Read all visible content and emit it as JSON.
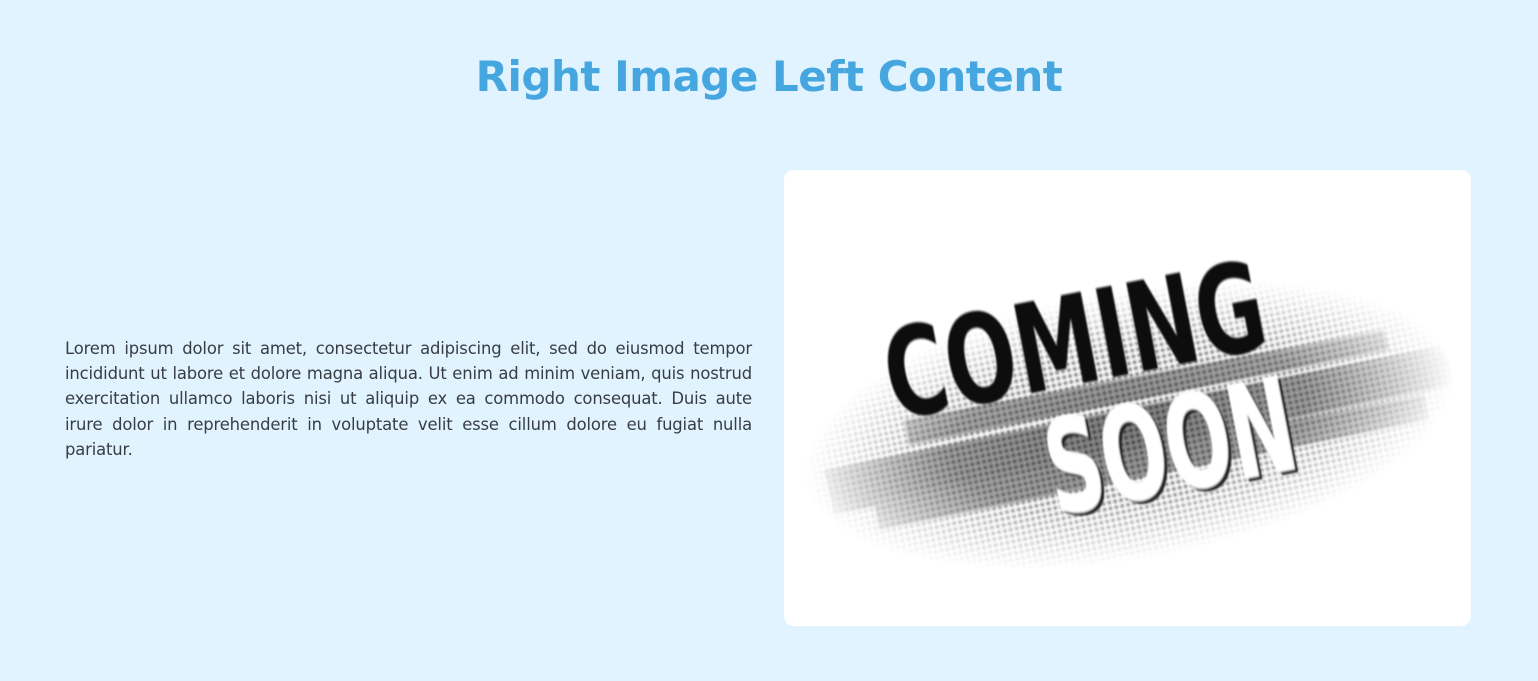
{
  "section": {
    "title": "Right Image Left Content",
    "body": "Lorem ipsum dolor sit amet, consectetur adipiscing elit, sed do eiusmod tempor incididunt ut labore et dolore magna aliqua. Ut enim ad minim veniam, quis nostrud exercitation ullamco laboris nisi ut aliquip ex ea commodo consequat. Duis aute irure dolor in reprehenderit in voluptate velit esse cillum dolore eu fugiat nulla pariatur."
  },
  "image": {
    "line_one": "COMING",
    "line_two": "SOON"
  },
  "colors": {
    "background": "#e0f3fe",
    "title": "#45a6e0",
    "body_text": "#383d44",
    "card": "#ffffff"
  }
}
